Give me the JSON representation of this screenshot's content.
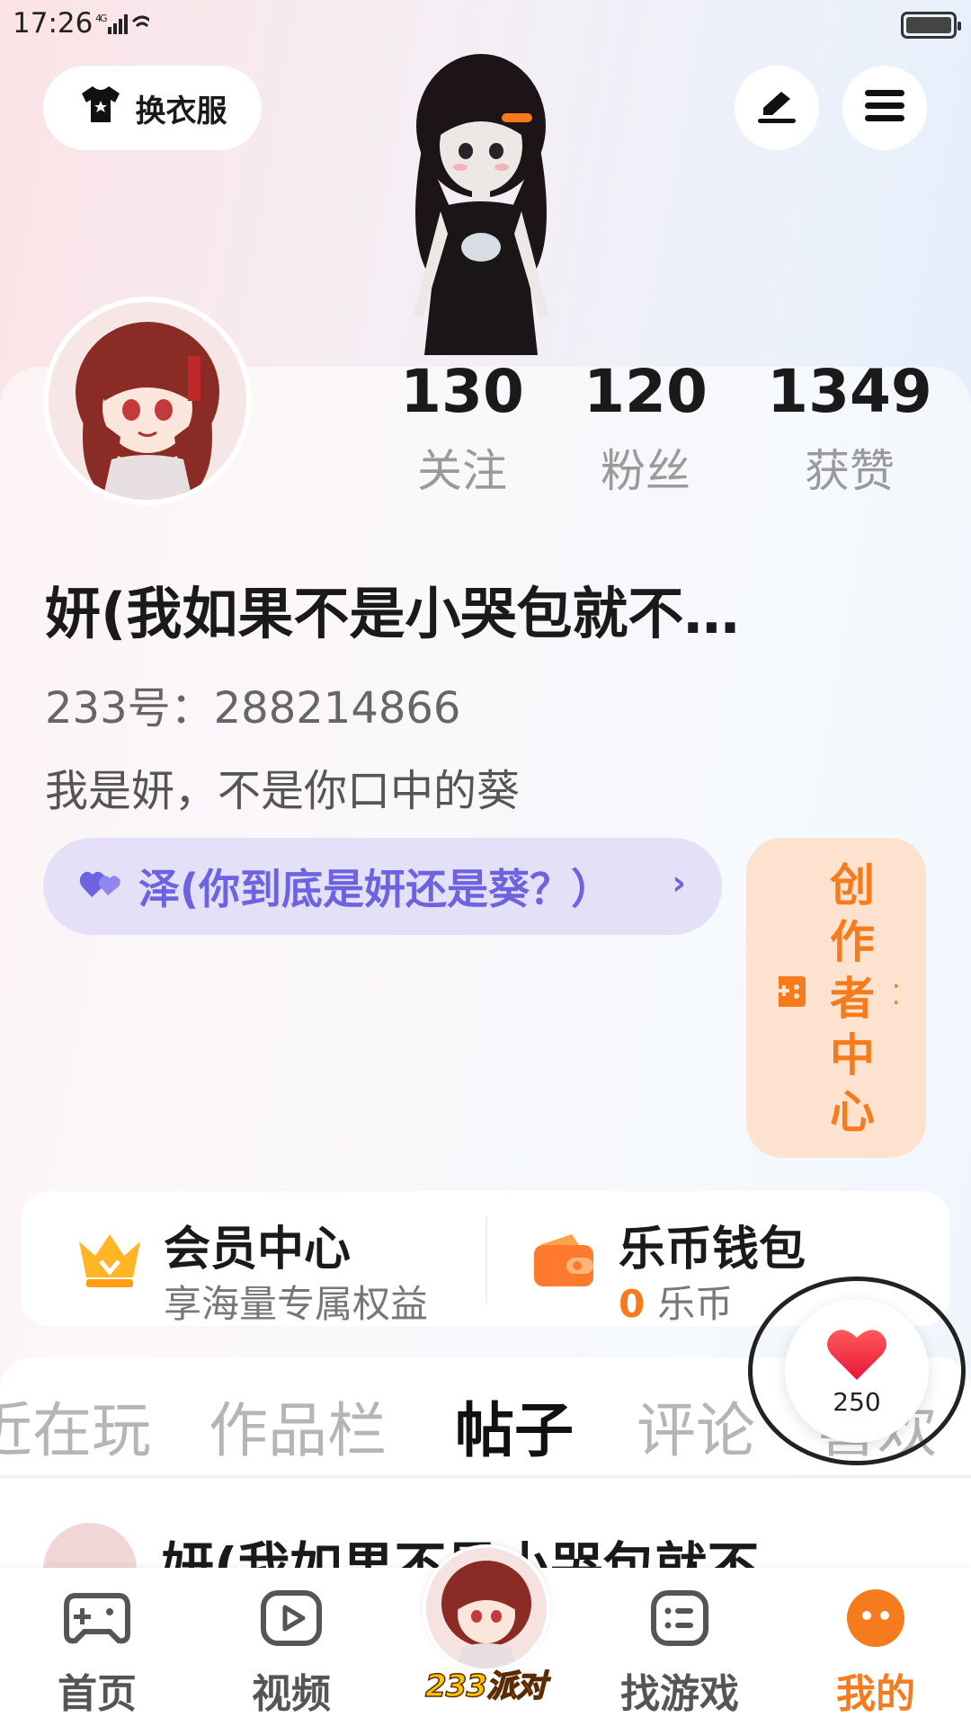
{
  "status_bar": {
    "time": "17:26",
    "network": "4G"
  },
  "header": {
    "outfit_label": "换衣服"
  },
  "stats": [
    {
      "num": "130",
      "label": "关注"
    },
    {
      "num": "120",
      "label": "粉丝"
    },
    {
      "num": "1349",
      "label": "获赞"
    }
  ],
  "profile": {
    "username": "妍(我如果不是小哭包就不…",
    "id": "233号：288214866",
    "bio": "我是妍，不是你口中的葵",
    "relation": "泽(你到底是妍还是葵？）",
    "relation_chevron": "›"
  },
  "creator": {
    "label": "创作者中心"
  },
  "member": {
    "title": "会员中心",
    "sub": "享海量专属权益"
  },
  "wallet": {
    "title": "乐币钱包",
    "count": "0",
    "unit": "乐币"
  },
  "tabs": [
    "近在玩",
    "作品栏",
    "帖子",
    "评论",
    "喜欢"
  ],
  "post": {
    "author": "妍(我如果不是小哭包就不"
  },
  "like_badge": {
    "count": "250"
  },
  "bottom_nav": {
    "home": "首页",
    "video": "视频",
    "center": "233派对",
    "find": "找游戏",
    "mine": "我的"
  },
  "colors": {
    "accent": "#f57b1c",
    "relation": "#6d63e0"
  }
}
